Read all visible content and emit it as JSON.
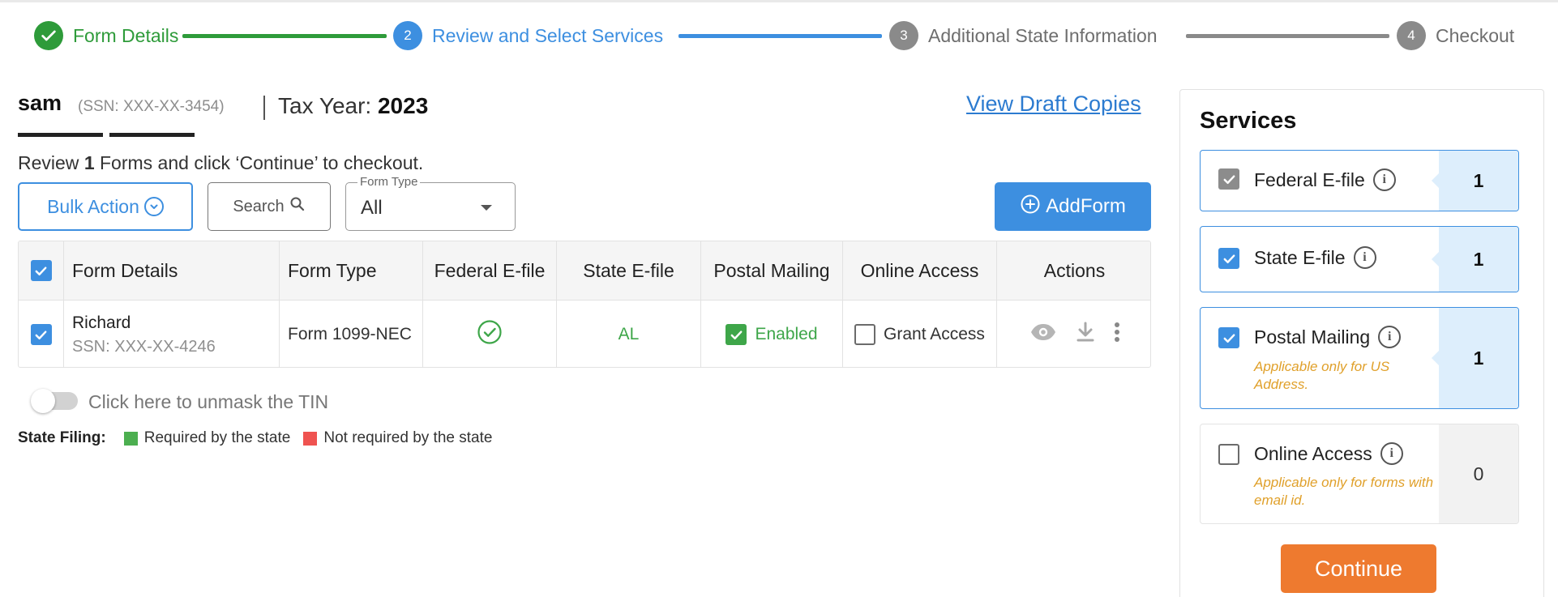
{
  "stepper": {
    "steps": [
      {
        "number": "",
        "label": "Form Details"
      },
      {
        "number": "2",
        "label": "Review and Select Services"
      },
      {
        "number": "3",
        "label": "Additional State Information"
      },
      {
        "number": "4",
        "label": "Checkout"
      }
    ]
  },
  "header": {
    "recipient_name": "sam",
    "ssn": "(SSN: XXX-XX-3454)",
    "tax_year_label": "Tax Year:",
    "tax_year": "2023",
    "view_draft_label": "View Draft Copies",
    "review_prefix": "Review",
    "review_count": "1",
    "review_suffix": "Forms and click ‘Continue’ to checkout."
  },
  "toolbar": {
    "bulk_action_label": "Bulk Action",
    "search_label": "Search",
    "form_type_legend": "Form Type",
    "form_type_value": "All",
    "add_form_label": "AddForm"
  },
  "table": {
    "columns": [
      "Form Details",
      "Form Type",
      "Federal E-file",
      "State E-file",
      "Postal Mailing",
      "Online Access",
      "Actions"
    ],
    "rows": [
      {
        "name": "Richard",
        "ssn": "SSN: XXX-XX-4246",
        "form_type": "Form 1099-NEC",
        "state": "AL",
        "postal_status": "Enabled",
        "online_access_label": "Grant Access"
      }
    ]
  },
  "unmask_label": "Click here to unmask the TIN",
  "state_filing": {
    "label": "State Filing:",
    "required_label": "Required by the state",
    "not_required_label": "Not required by the state"
  },
  "services": {
    "title": "Services",
    "items": [
      {
        "label": "Federal E-file",
        "note": "",
        "count": "1"
      },
      {
        "label": "State E-file",
        "note": "",
        "count": "1"
      },
      {
        "label": "Postal Mailing",
        "note": "Applicable only for US Address.",
        "count": "1"
      },
      {
        "label": "Online Access",
        "note": "Applicable only for forms with email id.",
        "count": "0"
      }
    ],
    "continue_label": "Continue"
  },
  "colors": {
    "complete_green": "#2e9b3a",
    "active_blue": "#3d8fe0",
    "inactive_gray": "#8a8a8a",
    "continue_orange": "#ee7a2f",
    "note_amber": "#e0a02a"
  },
  "icons": [
    "check-icon",
    "chevron-down-icon",
    "search-icon",
    "plus-circle-icon",
    "check-circle-icon",
    "eye-icon",
    "download-icon",
    "more-vertical-icon",
    "info-icon"
  ]
}
